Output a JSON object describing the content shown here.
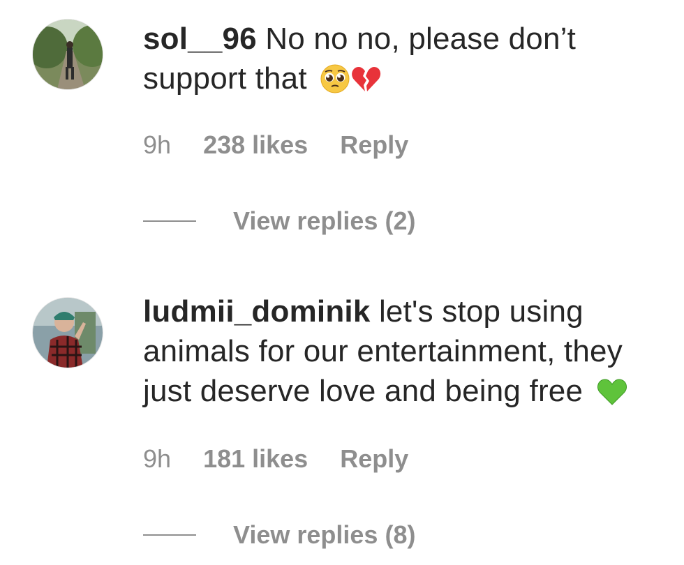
{
  "comments": [
    {
      "username": "sol__96",
      "text": "No no no, please don’t support that",
      "emojis": [
        "pleading-face-icon",
        "broken-heart-icon"
      ],
      "time": "9h",
      "likes": "238 likes",
      "reply_label": "Reply",
      "view_replies": "View replies (2)"
    },
    {
      "username": "ludmii_dominik",
      "text": "let's stop using animals for our entertainment, they just deserve love and being free",
      "emojis": [
        "green-heart-icon"
      ],
      "time": "9h",
      "likes": "181 likes",
      "reply_label": "Reply",
      "view_replies": "View replies (8)"
    }
  ],
  "colors": {
    "primary_text": "#262626",
    "secondary_text": "#8e8e8e",
    "background": "#ffffff",
    "green_heart": "#5fc33b",
    "broken_heart": "#e8333a"
  }
}
